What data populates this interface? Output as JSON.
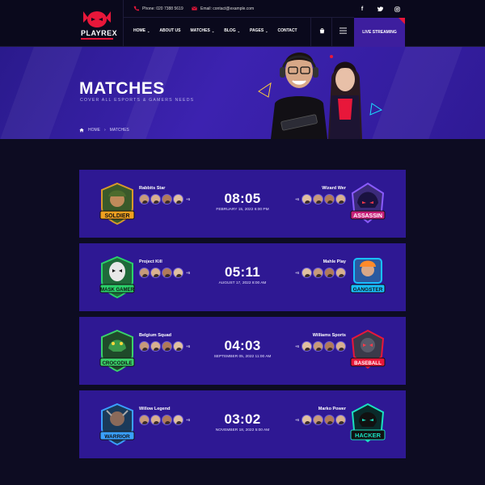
{
  "brand": {
    "name": "PLAYREX",
    "accent": "#e8173a",
    "primary": "#2e1893"
  },
  "topbar": {
    "phone": "Phone: 020 7388 5619",
    "email": "Email: contact@example.com",
    "social": [
      "facebook-icon",
      "twitter-icon",
      "instagram-icon"
    ]
  },
  "nav": {
    "items": [
      {
        "label": "HOME",
        "dropdown": true
      },
      {
        "label": "ABOUT US",
        "dropdown": false
      },
      {
        "label": "MATCHES",
        "dropdown": true
      },
      {
        "label": "BLOG",
        "dropdown": true
      },
      {
        "label": "PAGES",
        "dropdown": true
      },
      {
        "label": "CONTACT",
        "dropdown": false
      }
    ],
    "live_label": "LIVE STREAMING"
  },
  "hero": {
    "title": "MATCHES",
    "subtitle": "COVER ALL ESPORTS & GAMERS NEEDS",
    "breadcrumb": [
      "HOME",
      "MATCHES"
    ]
  },
  "matches": [
    {
      "team_a": "Rabbits Star",
      "team_b": "Wizard Wer",
      "extra_a": "+6",
      "extra_b": "+6",
      "time": "08:05",
      "date": "FEBRUARY 15, 2022 6:00 PM",
      "emblem_a": "SOLDIER",
      "emblem_b": "ASSASSIN"
    },
    {
      "team_a": "Project Kill",
      "team_b": "Mahle Play",
      "extra_a": "+6",
      "extra_b": "+6",
      "time": "05:11",
      "date": "AUGUST 17, 2022 8:00 AM",
      "emblem_a": "MASK GAMER",
      "emblem_b": "GANGSTER"
    },
    {
      "team_a": "Belgium Squad",
      "team_b": "Williams Sports",
      "extra_a": "+6",
      "extra_b": "+6",
      "time": "04:03",
      "date": "SEPTEMBER 05, 2022 11:00 AM",
      "emblem_a": "CROCODILE",
      "emblem_b": "BASEBALL"
    },
    {
      "team_a": "Willow Legend",
      "team_b": "Marko Power",
      "extra_a": "+6",
      "extra_b": "+6",
      "time": "03:02",
      "date": "NOVEMBER 18, 2022 5:00 AM",
      "emblem_a": "WARRIOR",
      "emblem_b": "HACKER"
    }
  ]
}
